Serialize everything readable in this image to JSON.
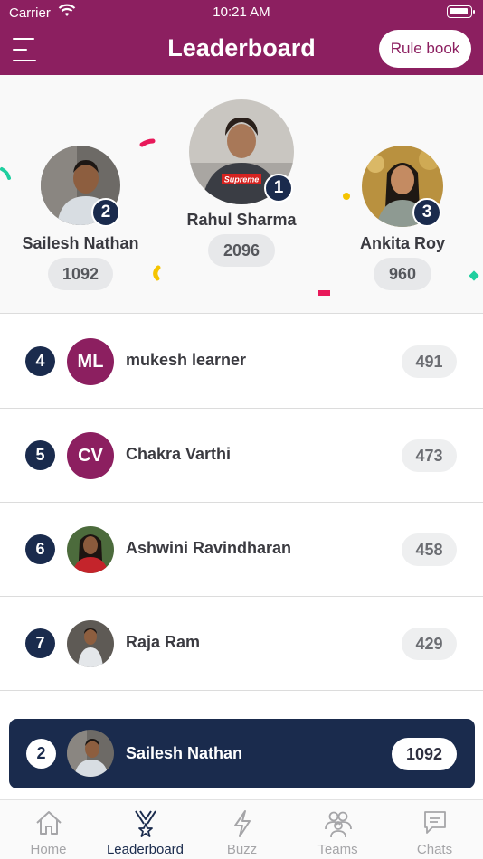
{
  "status_bar": {
    "carrier": "Carrier",
    "time": "10:21 AM"
  },
  "header": {
    "title": "Leaderboard",
    "rulebook_label": "Rule book"
  },
  "podium": [
    {
      "rank": "2",
      "name": "Sailesh Nathan",
      "score": "1092"
    },
    {
      "rank": "1",
      "name": "Rahul Sharma",
      "score": "2096",
      "shirt_text": "Supreme"
    },
    {
      "rank": "3",
      "name": "Ankita Roy",
      "score": "960"
    }
  ],
  "list": [
    {
      "rank": "4",
      "initials": "ML",
      "name": "mukesh learner",
      "score": "491"
    },
    {
      "rank": "5",
      "initials": "CV",
      "name": "Chakra Varthi",
      "score": "473"
    },
    {
      "rank": "6",
      "name": "Ashwini Ravindharan",
      "score": "458"
    },
    {
      "rank": "7",
      "name": "Raja Ram",
      "score": "429"
    }
  ],
  "my_rank": {
    "rank": "2",
    "name": "Sailesh Nathan",
    "score": "1092"
  },
  "tabs": [
    {
      "label": "Home",
      "icon": "home-icon"
    },
    {
      "label": "Leaderboard",
      "icon": "leaderboard-icon"
    },
    {
      "label": "Buzz",
      "icon": "bolt-icon"
    },
    {
      "label": "Teams",
      "icon": "teams-icon"
    },
    {
      "label": "Chats",
      "icon": "chat-icon"
    }
  ],
  "colors": {
    "brand": "#8c1f60",
    "navy": "#1a2b4d"
  }
}
